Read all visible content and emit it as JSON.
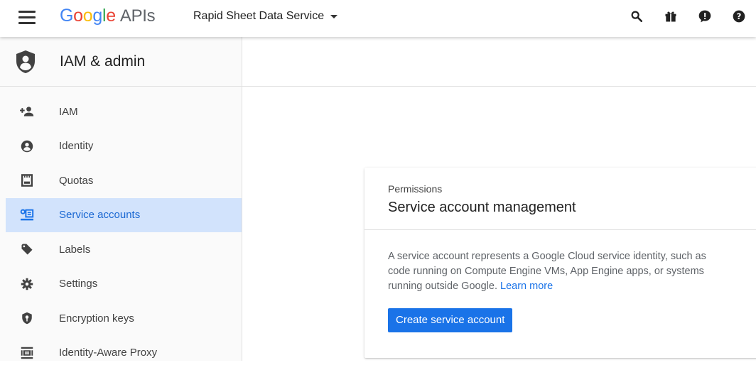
{
  "topbar": {
    "brand_google": "Google",
    "brand_apis": "APIs",
    "project_name": "Rapid Sheet Data Service",
    "icons": [
      "search-icon",
      "gift-icon",
      "notification-icon",
      "help-icon"
    ]
  },
  "sidebar": {
    "header_title": "IAM & admin",
    "items": [
      {
        "label": "IAM",
        "icon": "add-person-icon"
      },
      {
        "label": "Identity",
        "icon": "account-circle-icon"
      },
      {
        "label": "Quotas",
        "icon": "quota-icon"
      },
      {
        "label": "Service accounts",
        "icon": "service-account-icon",
        "active": true
      },
      {
        "label": "Labels",
        "icon": "label-icon"
      },
      {
        "label": "Settings",
        "icon": "gear-icon"
      },
      {
        "label": "Encryption keys",
        "icon": "security-shield-icon"
      },
      {
        "label": "Identity-Aware Proxy",
        "icon": "proxy-icon"
      }
    ]
  },
  "card": {
    "kicker": "Permissions",
    "title": "Service account management",
    "description": "A service account represents a Google Cloud service identity, such as code running on Compute Engine VMs, App Engine apps, or systems running outside Google.",
    "learn_more": "Learn more",
    "button_label": "Create service account"
  },
  "colors": {
    "accent": "#1a73e8",
    "active_bg": "#d2e3fc",
    "google_blue": "#4285f4",
    "google_red": "#ea4335",
    "google_yellow": "#fbbc05",
    "google_green": "#34a853"
  }
}
